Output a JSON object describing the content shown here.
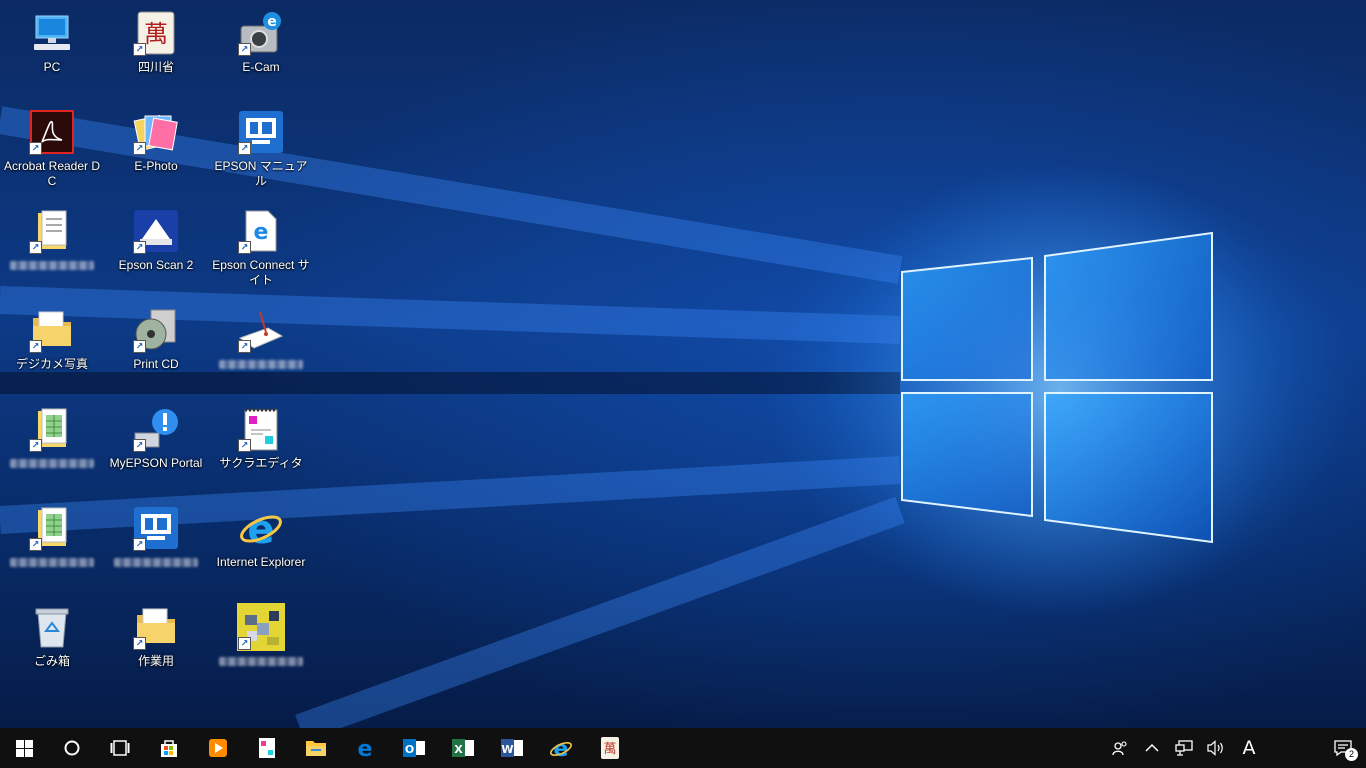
{
  "desktop": {
    "icons": [
      {
        "label": "PC",
        "icon": "pc-icon"
      },
      {
        "label": "四川省",
        "icon": "mahjong-game-icon"
      },
      {
        "label": "E-Cam",
        "icon": "ecam-icon"
      },
      {
        "label": "Acrobat Reader DC",
        "icon": "acrobat-reader-icon"
      },
      {
        "label": "E-Photo",
        "icon": "ephoto-icon"
      },
      {
        "label": "EPSON マニュアル",
        "icon": "epson-manual-icon"
      },
      {
        "label": "",
        "icon": "document-folder-icon",
        "blurred": true
      },
      {
        "label": "Epson Scan 2",
        "icon": "epson-scan-icon"
      },
      {
        "label": "Epson Connect サイト",
        "icon": "ie-document-icon"
      },
      {
        "label": "デジカメ写真",
        "icon": "folder-icon"
      },
      {
        "label": "Print CD",
        "icon": "print-cd-icon"
      },
      {
        "label": "",
        "icon": "postcard-app-icon",
        "blurred": true
      },
      {
        "label": "",
        "icon": "spreadsheet-folder-icon",
        "blurred": true
      },
      {
        "label": "MyEPSON Portal",
        "icon": "myepson-portal-icon"
      },
      {
        "label": "サクラエディタ",
        "icon": "sakura-editor-icon"
      },
      {
        "label": "",
        "icon": "spreadsheet-folder-icon",
        "blurred": true
      },
      {
        "label": "",
        "icon": "epson-manual-icon",
        "blurred": true
      },
      {
        "label": "Internet Explorer",
        "icon": "internet-explorer-icon"
      },
      {
        "label": "ごみ箱",
        "icon": "recycle-bin-icon"
      },
      {
        "label": "作業用",
        "icon": "folder-icon"
      },
      {
        "label": "",
        "icon": "pixelated-image-icon",
        "blurred": true
      }
    ]
  },
  "taskbar": {
    "start": "windows-start-icon",
    "search": "cortana-search-icon",
    "task_view": "task-view-icon",
    "pinned": [
      {
        "name": "store-icon",
        "color": "#f25022"
      },
      {
        "name": "media-player-icon",
        "color": "#ff8c00"
      },
      {
        "name": "sakura-editor-icon",
        "color": "#e83e8c"
      },
      {
        "name": "file-explorer-icon",
        "color": "#ffc83d"
      },
      {
        "name": "edge-icon",
        "color": "#0078d7"
      },
      {
        "name": "outlook-icon",
        "color": "#0072c6"
      },
      {
        "name": "excel-icon",
        "color": "#217346"
      },
      {
        "name": "word-icon",
        "color": "#2b579a"
      },
      {
        "name": "internet-explorer-icon",
        "color": "#1ea1f1"
      },
      {
        "name": "mahjong-game-icon",
        "color": "#c0392b"
      }
    ],
    "tray": {
      "people": "people-icon",
      "overflow": "chevron-up-icon",
      "network": "network-icon",
      "volume": "volume-icon",
      "ime_label": "A",
      "notifications_count": "2"
    }
  }
}
